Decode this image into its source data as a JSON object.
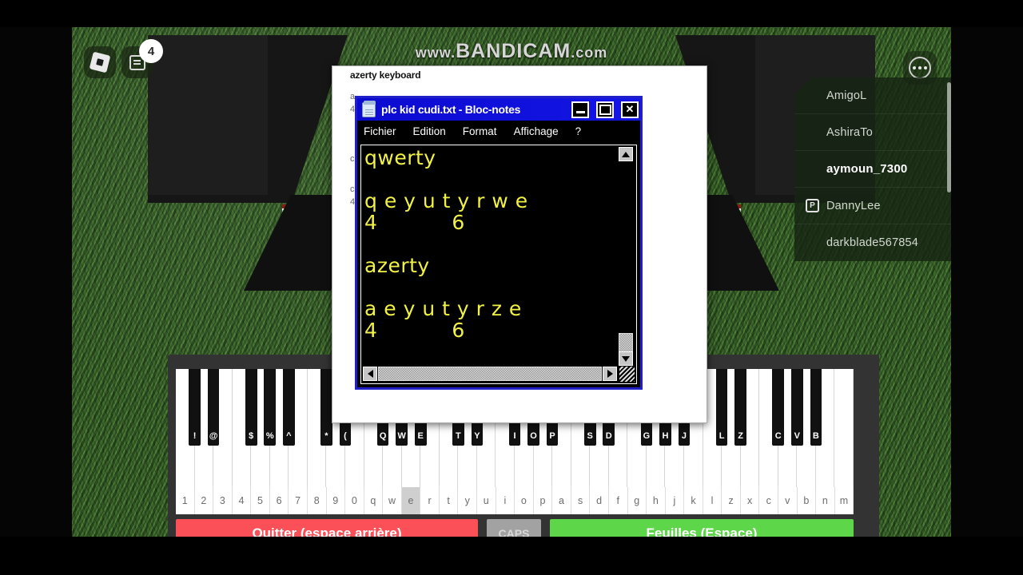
{
  "watermark": {
    "prefix": "www.",
    "main": "BANDICAM",
    "suffix": ".com"
  },
  "hud": {
    "roblox_icon": "roblox-logo-icon",
    "chat_icon": "chat-icon",
    "chat_badge": "4",
    "more_icon": "more-options-icon"
  },
  "player_list": {
    "players": [
      {
        "name": "AmigoL",
        "premium": false,
        "highlight": false
      },
      {
        "name": "AshiraTo",
        "premium": false,
        "highlight": false
      },
      {
        "name": "aymoun_7300",
        "premium": false,
        "highlight": true
      },
      {
        "name": "DannyLee",
        "premium": true,
        "highlight": false
      },
      {
        "name": "darkblade567854",
        "premium": false,
        "highlight": false
      }
    ],
    "premium_glyph": "P"
  },
  "piano_panel": {
    "white_key_labels": [
      "1",
      "2",
      "3",
      "4",
      "5",
      "6",
      "7",
      "8",
      "9",
      "0",
      "q",
      "w",
      "e",
      "r",
      "t",
      "y",
      "u",
      "i",
      "o",
      "p",
      "a",
      "s",
      "d",
      "f",
      "g",
      "h",
      "j",
      "k",
      "l",
      "z",
      "x",
      "c",
      "v",
      "b",
      "n",
      "m"
    ],
    "active_key": "e",
    "black_key_labels": [
      "!",
      "@",
      "$",
      "%",
      "^",
      "*",
      "(",
      "Q",
      "W",
      "E",
      "T",
      "Y",
      "I",
      "O",
      "P",
      "S",
      "D",
      "G",
      "H",
      "J",
      "L",
      "Z",
      "C",
      "V",
      "B"
    ],
    "buttons": {
      "quit": "Quitter (espace arrière)",
      "caps": "CAPS",
      "sheets": "Feuilles (Espace)"
    }
  },
  "background_window": {
    "title": "azerty keyboard",
    "faint_lines": [
      "a",
      "4",
      "c",
      "c",
      "4"
    ]
  },
  "notepad": {
    "title": "plc kid cudi.txt - Bloc-notes",
    "icon": "notepad-icon",
    "controls": {
      "minimize": "_",
      "maximize": "□",
      "close": "✕"
    },
    "menu": [
      "Fichier",
      "Edition",
      "Format",
      "Affichage",
      "?"
    ],
    "content": "qwerty\n\nq e y u t y r w e\n4           6\n\nazerty\n\na e y u t y r z e\n4           6",
    "text_color": "#f2f245",
    "background_color": "#000000",
    "title_bar_color": "#1414dc"
  },
  "colors": {
    "quit_button": "#fc5058",
    "sheets_button": "#5ed64a",
    "caps_button": "#a2a2a2",
    "grass": "#355c26",
    "panel": "#333333"
  }
}
